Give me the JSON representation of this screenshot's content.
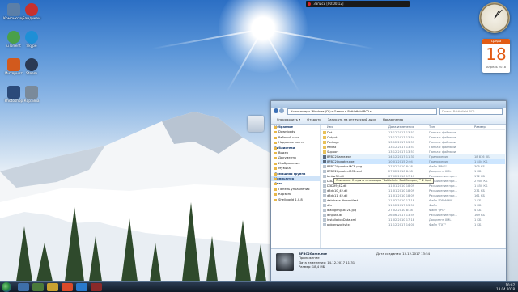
{
  "recorder": {
    "label": "Запись [00:00:12]"
  },
  "desktop_icons": [
    {
      "label": "Компьютер",
      "color": "#5b7fa8"
    },
    {
      "label": "Бандикам",
      "color": "#c7312e"
    },
    {
      "label": "uTorrent",
      "color": "#4aa04a"
    },
    {
      "label": "Skype",
      "color": "#1e8fd6"
    },
    {
      "label": "Интернет",
      "color": "#d25a1d"
    },
    {
      "label": "Steam",
      "color": "#2a3a55"
    },
    {
      "label": "Photoshop",
      "color": "#2b4a7a"
    },
    {
      "label": "Корзина",
      "color": "#7a8a9a"
    }
  ],
  "gadgets": {
    "calendar": {
      "weekday": "среда",
      "day": "18",
      "month": "Апрель 2018"
    }
  },
  "explorer": {
    "path": "Компьютер ▸ Windows (D:) ▸ Games ▸ Battlefield BC2 ▸",
    "search_placeholder": "Поиск: Battlefield BC2",
    "toolbar": [
      "Упорядочить ▾",
      "Открыть",
      "Записать на оптический диск",
      "Новая папка"
    ],
    "nav": [
      {
        "label": "Избранное",
        "hdr": true
      },
      {
        "label": "Downloads"
      },
      {
        "label": "Рабочий стол"
      },
      {
        "label": "Недавние места"
      },
      {
        "label": "Библиотеки",
        "hdr": true
      },
      {
        "label": "Видео"
      },
      {
        "label": "Документы"
      },
      {
        "label": "Изображения"
      },
      {
        "label": "Музыка"
      },
      {
        "label": "Домашняя группа",
        "hdr": true
      },
      {
        "label": "Компьютер",
        "hdr": true,
        "sel": true
      },
      {
        "label": "Сеть",
        "hdr": true
      },
      {
        "label": "Панель управления"
      },
      {
        "label": "Корзина"
      },
      {
        "label": "Shellworld 1.0.8"
      }
    ],
    "columns": [
      "Имя",
      "Дата изменения",
      "Тип",
      "Размер"
    ],
    "files": [
      {
        "name": "Dxt",
        "date": "13.12.2017 13:53",
        "type": "Папка с файлами",
        "size": ""
      },
      {
        "name": "Output",
        "date": "13.12.2017 13:54",
        "type": "Папка с файлами",
        "size": ""
      },
      {
        "name": "Package",
        "date": "13.12.2017 13:53",
        "type": "Папка с файлами",
        "size": ""
      },
      {
        "name": "Redist",
        "date": "13.12.2017 13:53",
        "type": "Папка с файлами",
        "size": ""
      },
      {
        "name": "Support",
        "date": "13.12.2017 13:53",
        "type": "Папка с файлами",
        "size": ""
      },
      {
        "name": "BFBC2Game.exe",
        "date": "14.12.2017 11:31",
        "type": "Приложение",
        "size": "18 876 КБ"
      },
      {
        "name": "BFBC2Updater.exe",
        "date": "10.01.2015 2:04",
        "type": "Приложение",
        "size": "1 804 КБ"
      },
      {
        "name": "BFBC2Updater-MCE.png",
        "date": "27.02.2010 8:38",
        "type": "Файл \"PNG\"",
        "size": "305 КБ"
      },
      {
        "name": "BFBC2Updater-MCE.xml",
        "date": "27.02.2010 8:38",
        "type": "Документ XML",
        "size": "1 КБ"
      },
      {
        "name": "binkw32.dll",
        "date": "07.02.2010 17:17",
        "type": "Расширение при...",
        "size": "172 КБ"
      },
      {
        "name": "D3DCompiler_42.dll",
        "date": "11.01.2010 18:09",
        "type": "Расширение при...",
        "size": "2 000 КБ"
      },
      {
        "name": "D3DX9_42.dll",
        "date": "11.01.2010 18:09",
        "type": "Расширение при...",
        "size": "1 850 КБ"
      },
      {
        "name": "d3dx10_42.dll",
        "date": "11.01.2010 18:09",
        "type": "Расширение при...",
        "size": "231 КБ"
      },
      {
        "name": "d3dx11_42.dll",
        "date": "11.01.2010 18:09",
        "type": "Расширение при...",
        "size": "161 КБ"
      },
      {
        "name": "database.dbmanifest",
        "date": "11.02.2010 17:18",
        "type": "Файл \"DBMANIF...",
        "size": "1 КБ"
      },
      {
        "name": "dfa",
        "date": "11.12.2017 13:50",
        "type": "Файл",
        "size": "1 КБ"
      },
      {
        "name": "dialogimg1BF2B.jpg",
        "date": "27.02.2010 8:38",
        "type": "Файл \"JPG\"",
        "size": "4 КБ"
      },
      {
        "name": "dinput8.dll",
        "date": "26.06.2017 13:59",
        "type": "Расширение при...",
        "size": "169 КБ"
      },
      {
        "name": "InstallationData.xml",
        "date": "11.02.2010 17:18",
        "type": "Документ XML",
        "size": "1 КБ"
      },
      {
        "name": "pbbansvocky.txt",
        "date": "11.12.2017 14:00",
        "type": "Файл \"TXT\"",
        "size": "1 КБ"
      }
    ],
    "tooltip": "Описание: Открыть с помощью \"Battlefield: Bad Company™ 2 Upd\"",
    "details": {
      "name": "BFBC2Game.exe",
      "date_label": "Дата изменения: 14.12.2017 11:31",
      "type": "Приложение",
      "size_label": "Размер: 18,4 МБ",
      "created_label": "Дата создания: 13.12.2017 13:54"
    }
  },
  "taskbar": {
    "time": "10:07",
    "date": "18.04.2018"
  }
}
